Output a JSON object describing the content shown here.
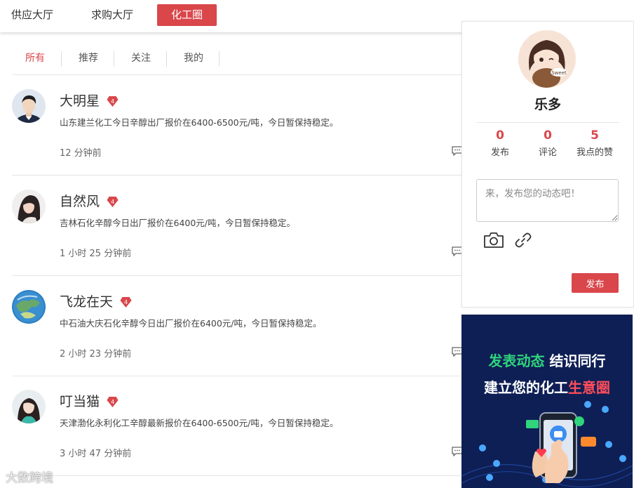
{
  "topnav": {
    "tabs": [
      {
        "label": "供应大厅"
      },
      {
        "label": "求购大厅"
      },
      {
        "label": "化工圈"
      }
    ]
  },
  "filters": {
    "tabs": [
      {
        "label": "所有"
      },
      {
        "label": "推荐"
      },
      {
        "label": "关注"
      },
      {
        "label": "我的"
      }
    ]
  },
  "posts": [
    {
      "name": "大明星",
      "level": "4",
      "content": "山东建兰化工今日辛醇出厂报价在6400-6500元/吨，今日暂保持稳定。",
      "time": "12 分钟前"
    },
    {
      "name": "自然风",
      "level": "4",
      "content": "吉林石化辛醇今日出厂报价在6400元/吨，今日暂保持稳定。",
      "time": "1 小时 25 分钟前"
    },
    {
      "name": "飞龙在天",
      "level": "4",
      "content": "中石油大庆石化辛醇今日出厂报价在6400元/吨，今日暂保持稳定。",
      "time": "2 小时 23 分钟前"
    },
    {
      "name": "叮当猫",
      "level": "4",
      "content": "天津渤化永利化工辛醇最新报价在6400-6500元/吨，今日暂保持稳定。",
      "time": "3 小时 47 分钟前"
    }
  ],
  "profile": {
    "username": "乐多",
    "avatar_tag": "Sweet",
    "stats": [
      {
        "value": "0",
        "label": "发布"
      },
      {
        "value": "0",
        "label": "评论"
      },
      {
        "value": "5",
        "label": "我点的赞"
      }
    ],
    "compose_placeholder": "来，发布您的动态吧！",
    "publish_label": "发布"
  },
  "banner": {
    "line1_a": "发表动态",
    "line1_b": "结识同行",
    "line2_a": "建立您的化工",
    "line2_b": "生意圈"
  },
  "watermark": "大数跨境",
  "colors": {
    "accent": "#d9474b",
    "banner_bg": "#0e1f55",
    "banner_green": "#2fd47c"
  }
}
